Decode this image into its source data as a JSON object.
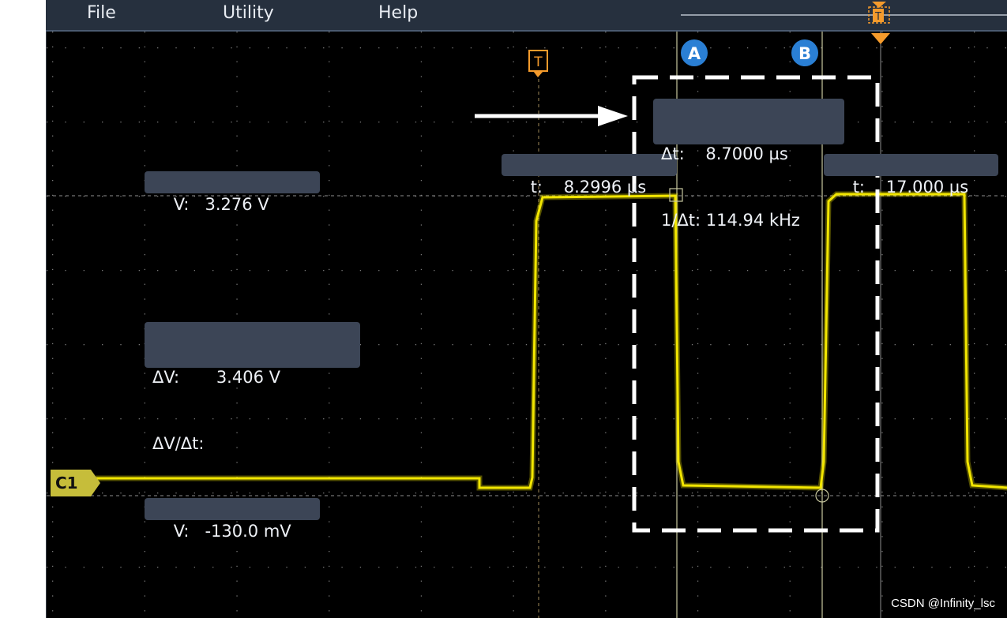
{
  "menu": {
    "file": "File",
    "utility": "Utility",
    "help": "Help"
  },
  "trigger": {
    "label": "T",
    "position_label": "T"
  },
  "cursors": {
    "a_label": "A",
    "b_label": "B",
    "a_time": "t:    8.2996 µs",
    "b_time": "t:    17.000 µs",
    "delta_t": "Δt:    8.7000 µs",
    "inv_delta_t": "1/Δt: 114.94 kHz",
    "v_high": "V:   3.276 V",
    "v_low": "V:   -130.0 mV",
    "delta_v": "ΔV:       3.406 V",
    "delta_v_dt": "ΔV/Δt:"
  },
  "channel": {
    "label": "C1",
    "color": "#f2e600",
    "marker_color": "#c6bd3a"
  },
  "colors": {
    "screen_bg": "#000000",
    "cursor_line": "#c9c9a0",
    "trigger_orange": "#f59b2c",
    "cursor_badge_blue": "#2a7fd4",
    "readout_bg": "#3c4556",
    "grid": "#9a9a9a"
  },
  "annotation": {
    "arrow_color": "#ffffff",
    "box_style": "dashed"
  },
  "watermark": "CSDN @Infinity_lsc"
}
